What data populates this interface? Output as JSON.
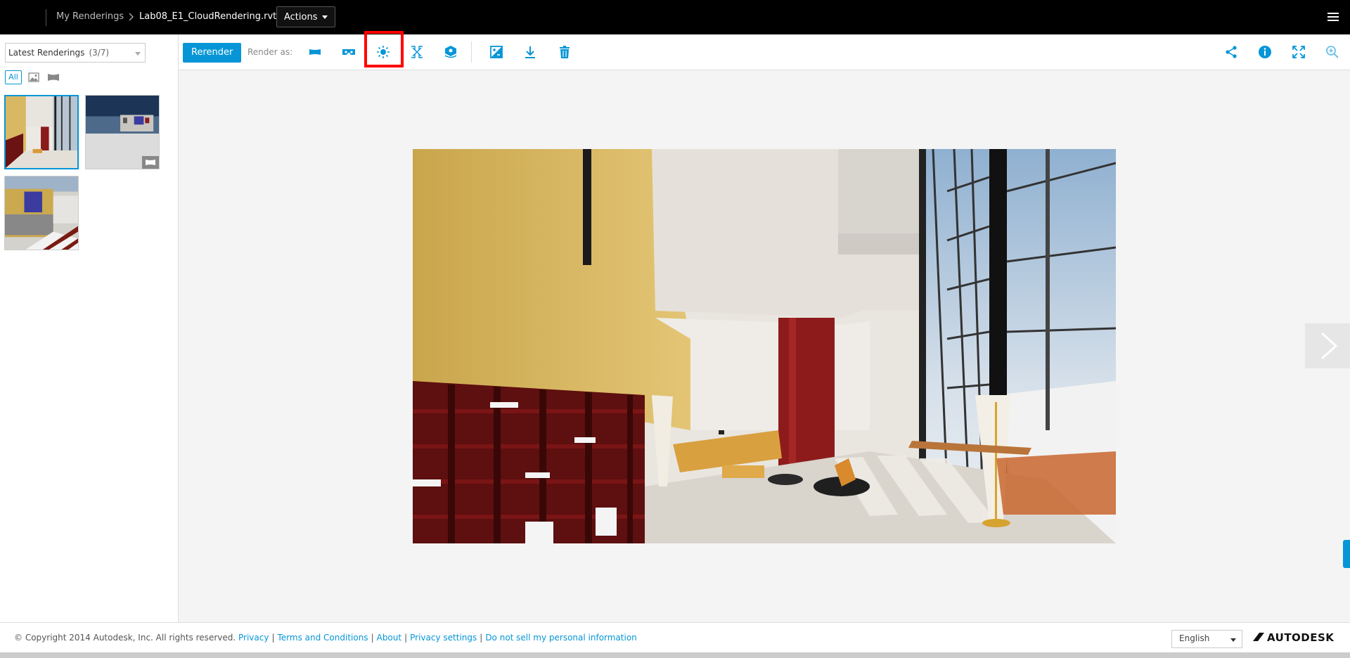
{
  "header": {
    "breadcrumb_root": "My Renderings",
    "file_name": "Lab08_E1_CloudRendering.rvt",
    "actions_label": "Actions"
  },
  "sidebar": {
    "select_label": "Latest Renderings",
    "select_count": "(3/7)",
    "filter_all": "All",
    "thumbnails": [
      {
        "name": "interior-living-room",
        "selected": true
      },
      {
        "name": "exterior-sky-panorama",
        "selected": false,
        "panorama": true
      },
      {
        "name": "exterior-facade",
        "selected": false
      }
    ]
  },
  "toolbar": {
    "rerender_label": "Rerender",
    "render_as_label": "Render as:",
    "tools": [
      "panorama-icon",
      "stereo-panorama-icon",
      "illuminance-icon",
      "solar-study-icon",
      "interactive-panorama-icon",
      "adjust-exposure-icon",
      "download-icon",
      "delete-icon"
    ],
    "right_tools": [
      "share-icon",
      "info-icon",
      "fullscreen-icon",
      "zoom-icon"
    ]
  },
  "footer": {
    "copyright": "© Copyright 2014 Autodesk, Inc. All rights reserved.",
    "links": [
      "Privacy",
      "Terms and Conditions",
      "About",
      "Privacy settings",
      "Do not sell my personal information"
    ],
    "language": "English",
    "logo": "AUTODESK"
  },
  "colors": {
    "accent": "#0696d7",
    "topbar": "#000000",
    "highlight": "#ff0000"
  }
}
